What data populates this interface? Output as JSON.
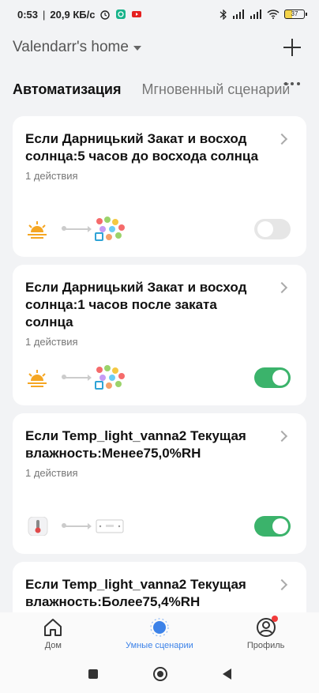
{
  "status_bar": {
    "time": "0:53",
    "speed": "20,9 КБ/с",
    "battery": "37"
  },
  "header": {
    "home_name": "Valendarr's home"
  },
  "tabs": [
    {
      "label": "Автоматизация",
      "active": true
    },
    {
      "label": "Мгновенный сценарий",
      "active": false
    }
  ],
  "cards": [
    {
      "title": "Если Дарницький Закат и восход солнца:5 часов до восхода солнца",
      "subtitle": "1 действия",
      "condition_icon": "sunrise-icon",
      "action_icon": "scene-lights-icon",
      "enabled": false
    },
    {
      "title": "Если Дарницький Закат и восход солнца:1 часов после заката солнца",
      "subtitle": "1 действия",
      "condition_icon": "sunset-icon",
      "action_icon": "scene-lights-icon",
      "enabled": true
    },
    {
      "title": "Если Temp_light_vanna2 Текущая влажность:Менее75,0%RH",
      "subtitle": "1 действия",
      "condition_icon": "thermometer-sensor-icon",
      "action_icon": "switch-device-icon",
      "enabled": true
    },
    {
      "title": "Если Temp_light_vanna2 Текущая влажность:Более75,4%RH",
      "subtitle": "",
      "condition_icon": "thermometer-sensor-icon",
      "action_icon": "switch-device-icon",
      "enabled": true
    }
  ],
  "bottom_nav": [
    {
      "label": "Дом",
      "icon": "home-icon",
      "active": false
    },
    {
      "label": "Умные сценарии",
      "icon": "smart-scene-icon",
      "active": true
    },
    {
      "label": "Профиль",
      "icon": "profile-icon",
      "active": false
    }
  ],
  "colors": {
    "accent": "#3c82e8",
    "toggle_on": "#3bb36b",
    "toggle_off": "#e6e6e6",
    "sun": "#f5a623"
  }
}
